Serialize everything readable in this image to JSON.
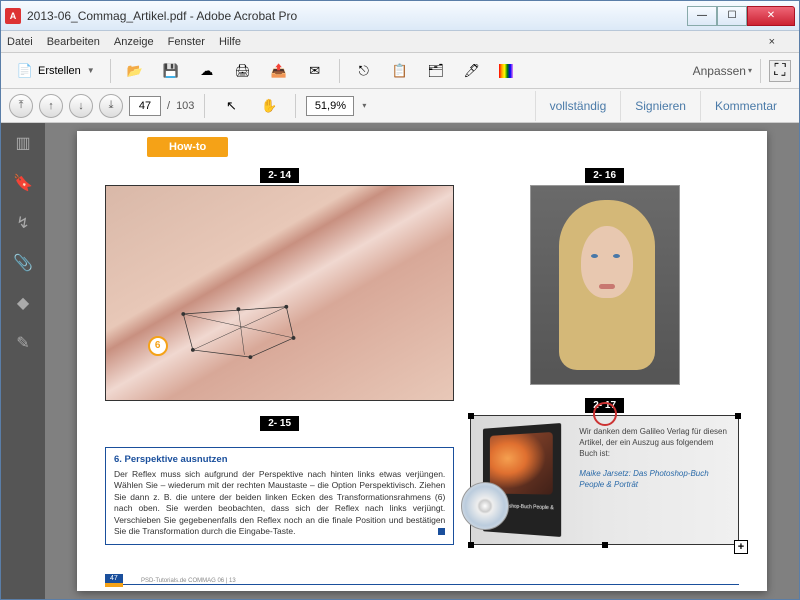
{
  "window": {
    "title": "2013-06_Commag_Artikel.pdf - Adobe Acrobat Pro"
  },
  "menu": {
    "file": "Datei",
    "edit": "Bearbeiten",
    "view": "Anzeige",
    "window": "Fenster",
    "help": "Hilfe"
  },
  "toolbar": {
    "create": "Erstellen",
    "customize": "Anpassen"
  },
  "nav": {
    "page": "47",
    "total": "103",
    "sep": "/",
    "zoom": "51,9%"
  },
  "tabs": {
    "full": "vollständig",
    "sign": "Signieren",
    "comment": "Kommentar"
  },
  "doc": {
    "howto": "How-to",
    "labels": {
      "a": "2- 14",
      "b": "2- 15",
      "c": "2- 16",
      "d": "2- 17"
    },
    "circle6": "6",
    "article": {
      "title": "6. Perspektive ausnutzen",
      "body": "Der Reflex muss sich aufgrund der Perspektive nach hinten links etwas verjüngen. Wählen Sie – wiederum mit der rechten Maustaste – die Option Perspektivisch. Ziehen Sie dann z. B. die untere der beiden linken Ecken des Transformationsrahmens (6) nach oben. Sie werden beobachten, dass sich der Reflex nach links verjüngt. Verschieben Sie gegebenenfalls den Reflex noch an die finale Position und bestätigen Sie die Transformation durch die Eingabe-Taste."
    },
    "book": {
      "coverTitle": "Das Photoshop-Buch People & Porträt",
      "thanks": "Wir danken dem Galileo Verlag für diesen Artikel, der ein Auszug aus folgendem Buch ist:",
      "ref": "Maike Jarsetz: Das Photoshop-Buch People & Porträt"
    },
    "footer": {
      "pagenum": "47",
      "text": "PSD-Tutorials.de  COMMAG 06 | 13"
    },
    "plus": "+"
  }
}
